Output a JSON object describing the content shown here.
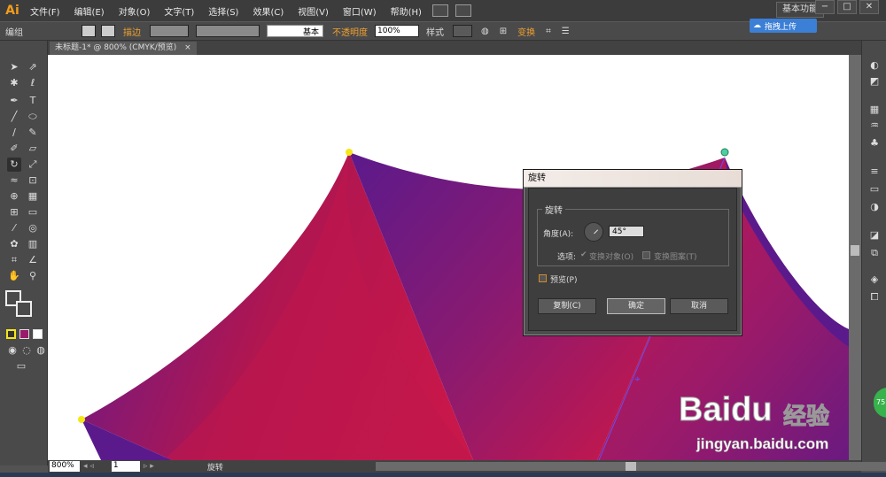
{
  "app": {
    "logo": "Ai"
  },
  "menu": [
    "文件(F)",
    "编辑(E)",
    "对象(O)",
    "文字(T)",
    "选择(S)",
    "效果(C)",
    "视图(V)",
    "窗口(W)",
    "帮助(H)"
  ],
  "workspace": "基本功能",
  "window_buttons": [
    "−",
    "□",
    "✕"
  ],
  "cloud_upload": "拖拽上传",
  "control_bar": {
    "group_label": "编组",
    "stroke_label": "描边",
    "stroke_style": "基本",
    "opacity_label": "不透明度",
    "opacity_value": "100%",
    "style_label": "样式",
    "transform_label": "变换"
  },
  "document_tab": {
    "title": "未标题-1* @ 800% (CMYK/预览)",
    "close": "×"
  },
  "canvas": {
    "colors": {
      "dark_purple": "#5b1a8c",
      "crimson": "#c8174a",
      "magenta": "#9a1a6a",
      "anchor": "#f5e61a"
    }
  },
  "dialog": {
    "title": "旋转",
    "group_title": "旋转",
    "angle_label": "角度(A):",
    "angle_value": "45°",
    "options_label": "选项:",
    "transform_objects": "变换对象(O)",
    "transform_patterns": "变换图案(T)",
    "preview": "预览(P)",
    "copy_button": "复制(C)",
    "ok_button": "确定",
    "cancel_button": "取消"
  },
  "status_bar": {
    "zoom": "800%",
    "page": "1",
    "status_text": "旋转"
  },
  "watermark": {
    "brand": "Baidu",
    "brand_cn": "经验",
    "url": "jingyan.baidu.com",
    "badge": "75"
  }
}
